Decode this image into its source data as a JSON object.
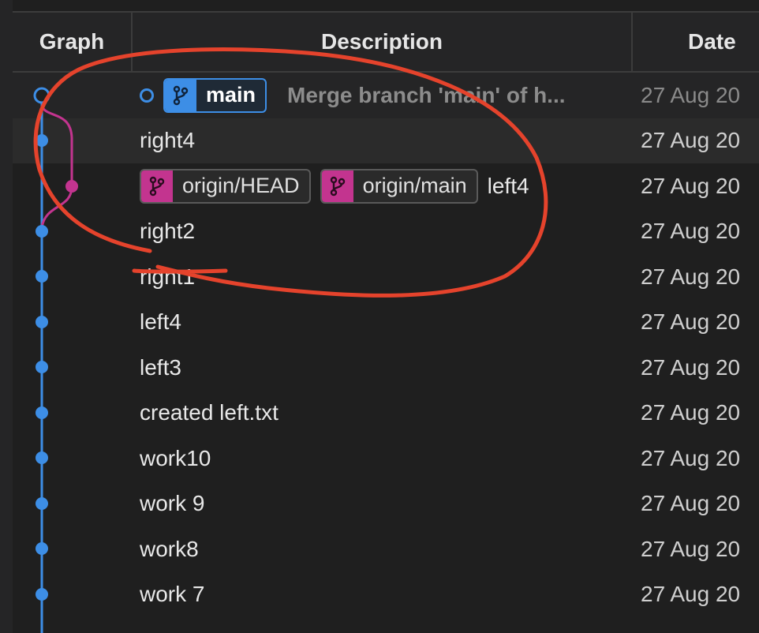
{
  "columns": {
    "graph": "Graph",
    "description": "Description",
    "date": "Date"
  },
  "head_commit": {
    "branch_badge": "main",
    "message": "Merge branch 'main' of h...",
    "date": "27 Aug 20"
  },
  "commits": [
    {
      "message": "right4",
      "date": "27 Aug 20"
    },
    {
      "badges": [
        "origin/HEAD",
        "origin/main"
      ],
      "message": "left4",
      "date": "27 Aug 20"
    },
    {
      "message": "right2",
      "date": "27 Aug 20"
    },
    {
      "message": "right1",
      "date": "27 Aug 20"
    },
    {
      "message": "left4",
      "date": "27 Aug 20"
    },
    {
      "message": "left3",
      "date": "27 Aug 20"
    },
    {
      "message": "created left.txt",
      "date": "27 Aug 20"
    },
    {
      "message": "work10",
      "date": "27 Aug 20"
    },
    {
      "message": "work 9",
      "date": "27 Aug 20"
    },
    {
      "message": "work8",
      "date": "27 Aug 20"
    },
    {
      "message": "work 7",
      "date": "27 Aug 20"
    }
  ],
  "icons": {
    "branch": "git-branch-icon",
    "commit_dot": "commit-dot-icon",
    "head_ring": "head-ring-icon"
  },
  "colors": {
    "main_line": "#3d8ee6",
    "merged_line": "#c3348f",
    "annotation": "#e5432c"
  }
}
